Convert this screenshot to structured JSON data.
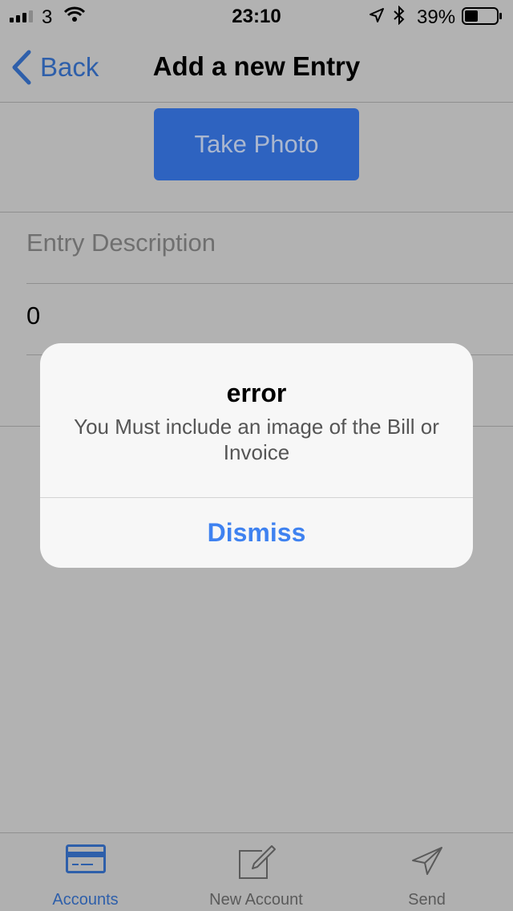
{
  "status_bar": {
    "carrier": "3",
    "time": "23:10",
    "battery_percent": "39%"
  },
  "nav": {
    "back_label": "Back",
    "title": "Add a new Entry"
  },
  "form": {
    "take_photo_label": "Take Photo",
    "description_placeholder": "Entry Description",
    "amount_value": "0"
  },
  "alert": {
    "title": "error",
    "message": "You Must include an image of the Bill or Invoice",
    "dismiss_label": "Dismiss"
  },
  "tabs": [
    {
      "label": "Accounts",
      "icon": "credit-card-icon",
      "active": true
    },
    {
      "label": "New Account",
      "icon": "compose-icon",
      "active": false
    },
    {
      "label": "Send",
      "icon": "send-icon",
      "active": false
    }
  ],
  "colors": {
    "accent": "#2e5faa",
    "photo_button": "#2e63c0",
    "dismiss": "#3f82f0",
    "dimmed_background": "#b2b2b2"
  }
}
